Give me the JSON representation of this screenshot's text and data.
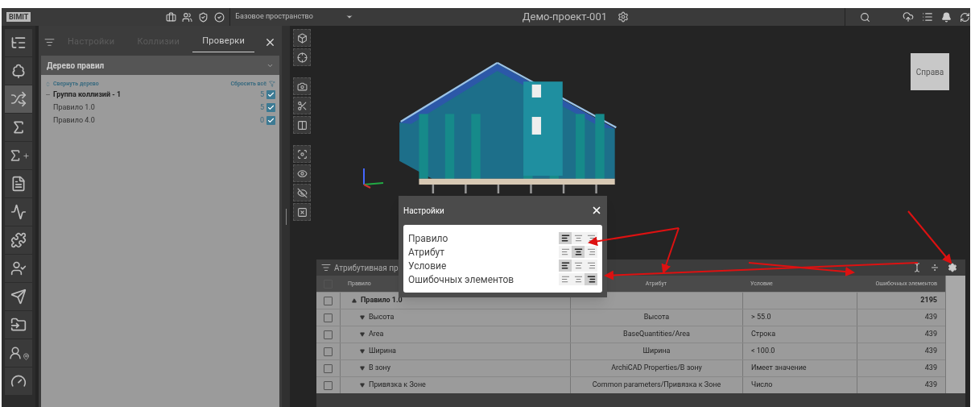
{
  "top_bar": {
    "logo": "BIMIT",
    "workspace": "Базовое пространство",
    "project_title": "Демо-проект-001"
  },
  "rail": {
    "items": [
      {
        "kind": "tree",
        "selected": false
      },
      {
        "kind": "cloud",
        "selected": false
      },
      {
        "kind": "shuffle",
        "selected": true
      },
      {
        "kind": "sigma",
        "selected": false
      },
      {
        "kind": "sigma-plus",
        "selected": false
      },
      {
        "kind": "document",
        "selected": false
      },
      {
        "kind": "chart",
        "selected": false
      },
      {
        "kind": "puzzle",
        "selected": false
      },
      {
        "kind": "user-check",
        "selected": false
      },
      {
        "kind": "send",
        "selected": false
      },
      {
        "kind": "folder",
        "selected": false
      },
      {
        "kind": "user-pin",
        "selected": false
      },
      {
        "kind": "gauge",
        "selected": false
      }
    ]
  },
  "left_panel": {
    "tabs": [
      {
        "label": "Настройки",
        "selected": false
      },
      {
        "label": "Коллизии",
        "selected": false
      },
      {
        "label": "Проверки",
        "selected": true
      }
    ],
    "dropdown": "Дерево правил",
    "collapse_link": "Свернуть дерево",
    "reset_link": "Сбросить всё",
    "tree": [
      {
        "label": "Группа коллизий - 1",
        "count": "5",
        "checked": true,
        "expanded": true,
        "children": [
          {
            "label": "Правило 1.0",
            "count": "5",
            "checked": true
          },
          {
            "label": "Правило 4.0",
            "count": "0",
            "checked": true
          }
        ]
      }
    ]
  },
  "view_cube": "Справа",
  "table_panel": {
    "title": "Атрибутивная пр",
    "header_checked": false,
    "columns": [
      "Правило",
      "Атрибут",
      "Условие",
      "Ошибочных элементов"
    ],
    "rows": [
      {
        "kind": "group",
        "rule": "Правило 1.0",
        "expanded": true,
        "checked": false,
        "errors": "2195"
      },
      {
        "kind": "item",
        "rule": "Высота",
        "expanded": false,
        "checked": false,
        "attribute": "Высота",
        "condition": "> 55.0",
        "errors": "439"
      },
      {
        "kind": "item",
        "rule": "Area",
        "expanded": false,
        "checked": false,
        "attribute": "BaseQuantities/Area",
        "condition": "Строка",
        "errors": "439"
      },
      {
        "kind": "item",
        "rule": "Ширина",
        "expanded": false,
        "checked": false,
        "attribute": "Ширина",
        "condition": "< 100.0",
        "errors": "439"
      },
      {
        "kind": "item",
        "rule": "В зону",
        "expanded": false,
        "checked": false,
        "attribute": "ArchiCAD Properties/В зону",
        "condition": "Имеет значение",
        "errors": "439"
      },
      {
        "kind": "item",
        "rule": "Привязка к Зоне",
        "expanded": false,
        "checked": false,
        "attribute": "Common parameters/Привязка к Зоне",
        "condition": "Число",
        "errors": "439"
      }
    ]
  },
  "dialog": {
    "title": "Настройки",
    "rows": [
      {
        "label": "Правило",
        "alignments": [
          {
            "kind": "left",
            "selected": true
          },
          {
            "kind": "center",
            "selected": false
          },
          {
            "kind": "right",
            "selected": false
          }
        ]
      },
      {
        "label": "Атрибут",
        "alignments": [
          {
            "kind": "left",
            "selected": false
          },
          {
            "kind": "center",
            "selected": true
          },
          {
            "kind": "right",
            "selected": false
          }
        ]
      },
      {
        "label": "Условие",
        "alignments": [
          {
            "kind": "left",
            "selected": true
          },
          {
            "kind": "center",
            "selected": false
          },
          {
            "kind": "right",
            "selected": false
          }
        ]
      },
      {
        "label": "Ошибочных элементов",
        "alignments": [
          {
            "kind": "left",
            "selected": false
          },
          {
            "kind": "center",
            "selected": false
          },
          {
            "kind": "right",
            "selected": true
          }
        ]
      }
    ]
  }
}
